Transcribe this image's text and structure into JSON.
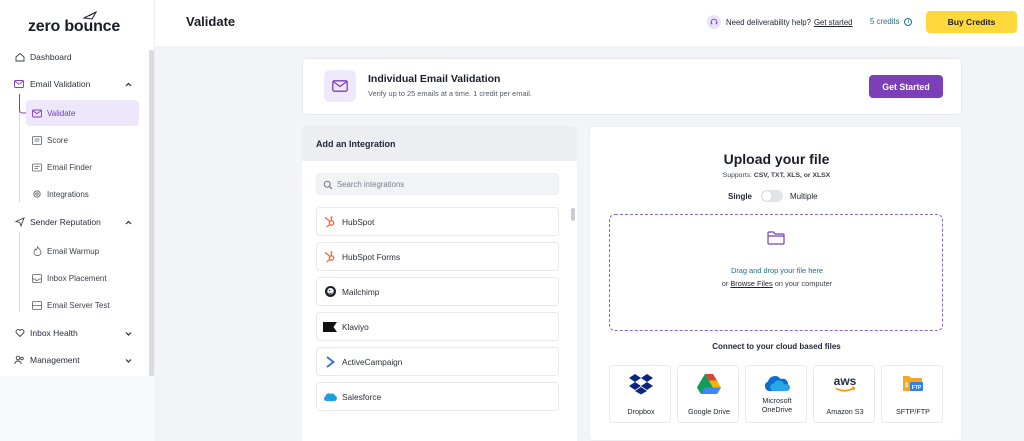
{
  "brand": {
    "logo_text": "zero bounce"
  },
  "sidebar": {
    "items": [
      {
        "label": "Dashboard",
        "icon": "home-icon"
      },
      {
        "label": "Email Validation",
        "icon": "mail-check-icon"
      },
      {
        "label": "Sender Reputation",
        "icon": "send-icon"
      },
      {
        "label": "Inbox Health",
        "icon": "heart-icon"
      },
      {
        "label": "Management",
        "icon": "people-icon"
      }
    ],
    "email_validation_sub": [
      {
        "label": "Validate",
        "icon": "mail-icon",
        "active": true
      },
      {
        "label": "Score",
        "icon": "score-icon"
      },
      {
        "label": "Email Finder",
        "icon": "finder-icon"
      },
      {
        "label": "Integrations",
        "icon": "gear-icon"
      }
    ],
    "sender_reputation_sub": [
      {
        "label": "Email Warmup",
        "icon": "flame-icon"
      },
      {
        "label": "Inbox Placement",
        "icon": "inbox-icon"
      },
      {
        "label": "Email Server Test",
        "icon": "server-icon"
      }
    ]
  },
  "header": {
    "title": "Validate",
    "help_text": "Need deliverability help?",
    "help_link": "Get started",
    "credits": "5 credits",
    "buy_label": "Buy Credits"
  },
  "individual": {
    "title": "Individual Email Validation",
    "subtitle": "Verify up to 25 emails at a time. 1 credit per email.",
    "button": "Get Started"
  },
  "integrations": {
    "title": "Add an Integration",
    "search_placeholder": "Search integrations",
    "items": [
      {
        "label": "HubSpot",
        "icon": "hubspot-icon"
      },
      {
        "label": "HubSpot Forms",
        "icon": "hubspot-icon"
      },
      {
        "label": "Mailchimp",
        "icon": "mailchimp-icon"
      },
      {
        "label": "Klaviyo",
        "icon": "klaviyo-icon"
      },
      {
        "label": "ActiveCampaign",
        "icon": "activecampaign-icon"
      },
      {
        "label": "Salesforce",
        "icon": "salesforce-icon"
      }
    ]
  },
  "upload": {
    "title": "Upload your file",
    "supports_prefix": "Supports: ",
    "supports_types": "CSV, TXT, XLS, or XLSX",
    "toggle_single": "Single",
    "toggle_multiple": "Multiple",
    "drag_text": "Drag and drop your file here",
    "or_text": "or ",
    "browse_link": "Browse Files",
    "on_computer": " on your computer",
    "cloud_title": "Connect to your cloud based files",
    "clouds": [
      {
        "label": "Dropbox",
        "icon": "dropbox-icon"
      },
      {
        "label": "Google Drive",
        "icon": "google-drive-icon"
      },
      {
        "label": "Microsoft OneDrive",
        "label_line1": "Microsoft",
        "label_line2": "OneDrive",
        "icon": "onedrive-icon"
      },
      {
        "label": "Amazon S3",
        "icon": "aws-icon"
      },
      {
        "label": "SFTP/FTP",
        "icon": "sftp-icon"
      }
    ]
  },
  "colors": {
    "accent_purple": "#7c3fb8",
    "buy_yellow": "#ffd93b",
    "active_bg": "#eee6fb",
    "link_teal": "#1d6f8e"
  }
}
